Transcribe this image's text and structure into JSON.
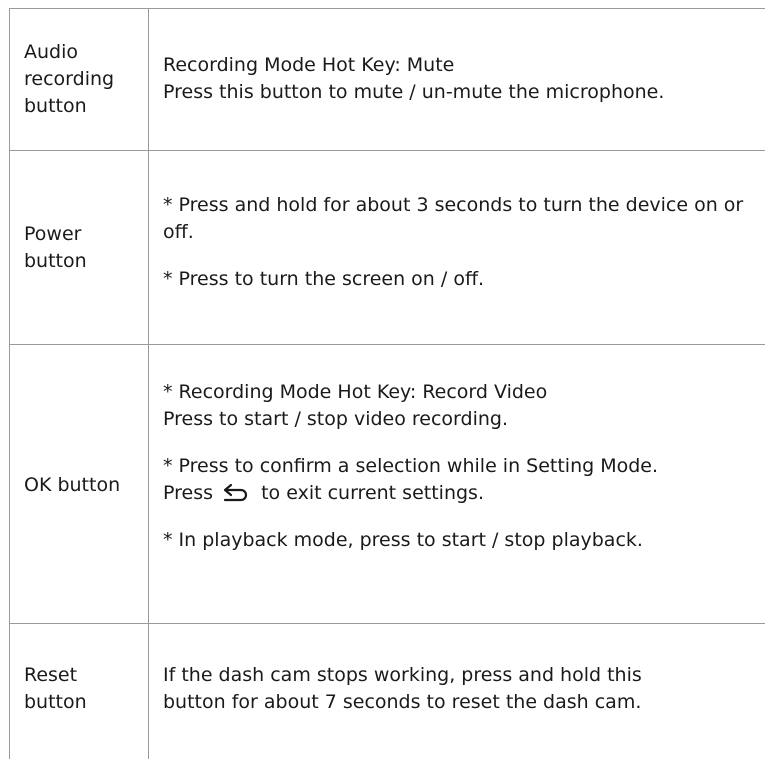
{
  "rows": [
    {
      "label": "Audio recording button",
      "lines": [
        "Recording Mode Hot Key: Mute",
        "Press this button to mute / un-mute the microphone."
      ]
    },
    {
      "label": "Power button",
      "paragraphs": [
        "* Press and hold for about 3 seconds to turn the device on or off.",
        "* Press to turn the screen on / off."
      ]
    },
    {
      "label": "OK button",
      "p1_line1": "* Recording Mode Hot Key: Record Video",
      "p1_line2": "Press to start / stop video recording.",
      "p2_line1": "* Press to confirm a selection while in Setting Mode.",
      "p2_pre": "Press",
      "p2_post": "to exit current settings.",
      "p2_icon": "back-arrow-icon",
      "p3": "* In playback mode, press to start / stop playback."
    },
    {
      "label": "Reset button",
      "lines": [
        "If the dash cam stops working, press and hold this",
        "button for about 7 seconds to reset the dash cam."
      ]
    }
  ]
}
